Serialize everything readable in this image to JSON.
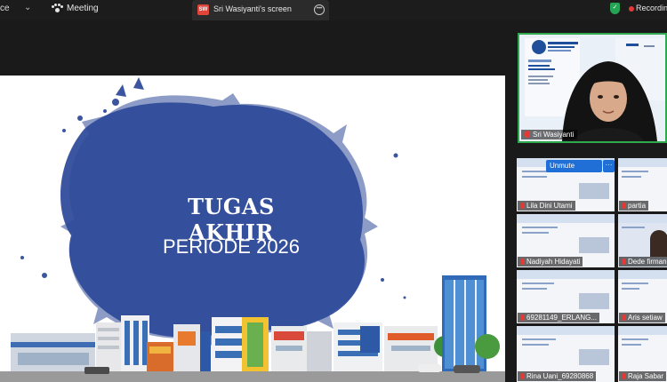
{
  "topbar": {
    "left_label": "ce",
    "meeting_label": "Meeting",
    "share_badge": "SW",
    "share_label": "Sri Wasiyanti's screen",
    "recording_label": "Recording"
  },
  "slide": {
    "title": "TUGAS AKHIR",
    "period": "PERIODE 2026",
    "splash_color": "#3b55a0"
  },
  "speaker": {
    "name": "Sri Wasiyanti"
  },
  "gallery": {
    "unmute_label": "Unmute",
    "participants": [
      {
        "name": "Lila Dini Utami"
      },
      {
        "name": "partia"
      },
      {
        "name": "Nadiyah Hidayati"
      },
      {
        "name": "Dede firman"
      },
      {
        "name": "69281149_ERLANG..."
      },
      {
        "name": "Aris setiaw"
      },
      {
        "name": "Rina Uani_69280868"
      },
      {
        "name": "Raja Sabar"
      }
    ]
  },
  "colors": {
    "active_speaker_border": "#2fa84f",
    "record_red": "#e53935",
    "unmute_blue": "#1f6fd6"
  }
}
